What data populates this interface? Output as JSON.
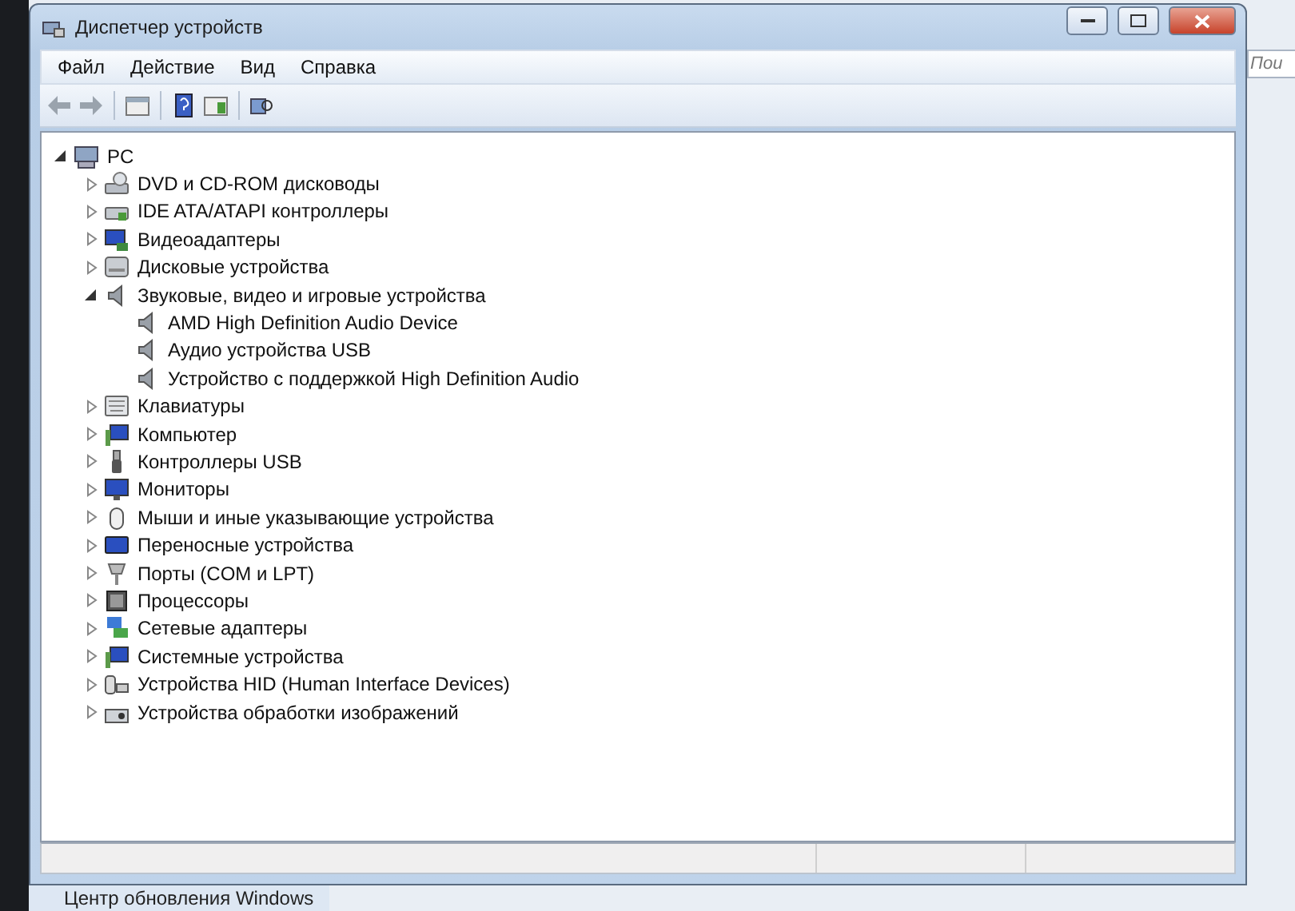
{
  "window": {
    "title": "Диспетчер устройств"
  },
  "menu": [
    "Файл",
    "Действие",
    "Вид",
    "Справка"
  ],
  "tree": {
    "label": "PC",
    "expanded": true,
    "children": [
      {
        "label": "DVD и CD-ROM дисководы",
        "expanded": false
      },
      {
        "label": "IDE ATA/ATAPI контроллеры",
        "expanded": false
      },
      {
        "label": "Видеоадаптеры",
        "expanded": false
      },
      {
        "label": "Дисковые устройства",
        "expanded": false
      },
      {
        "label": "Звуковые, видео и игровые устройства",
        "expanded": true,
        "children": [
          {
            "label": "AMD High Definition Audio Device"
          },
          {
            "label": "Аудио устройства USB"
          },
          {
            "label": "Устройство с поддержкой High Definition Audio"
          }
        ]
      },
      {
        "label": "Клавиатуры",
        "expanded": false
      },
      {
        "label": "Компьютер",
        "expanded": false
      },
      {
        "label": "Контроллеры USB",
        "expanded": false
      },
      {
        "label": "Мониторы",
        "expanded": false
      },
      {
        "label": "Мыши и иные указывающие устройства",
        "expanded": false
      },
      {
        "label": "Переносные устройства",
        "expanded": false
      },
      {
        "label": "Порты (COM и LPT)",
        "expanded": false
      },
      {
        "label": "Процессоры",
        "expanded": false
      },
      {
        "label": "Сетевые адаптеры",
        "expanded": false
      },
      {
        "label": "Системные устройства",
        "expanded": false
      },
      {
        "label": "Устройства HID (Human Interface Devices)",
        "expanded": false
      },
      {
        "label": "Устройства обработки изображений",
        "expanded": false
      }
    ]
  },
  "background": {
    "search_placeholder": "Пои",
    "taskbar_item": "Центр обновления Windows"
  }
}
